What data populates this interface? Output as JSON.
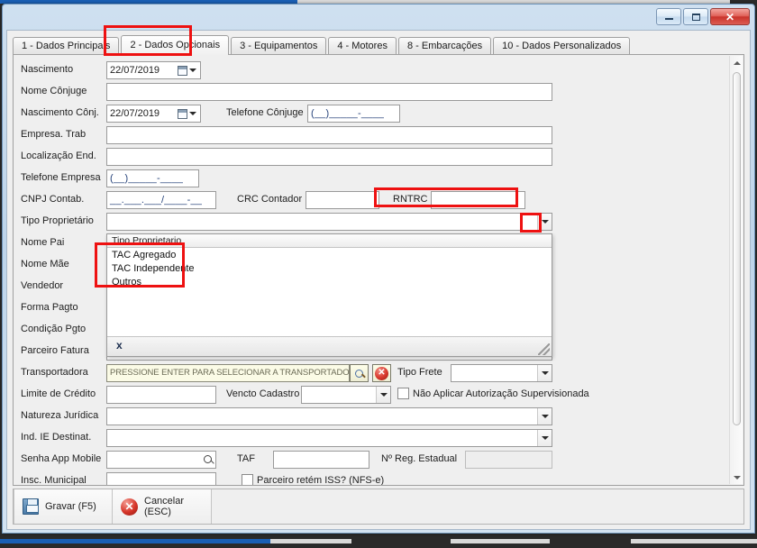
{
  "window": {
    "title": "",
    "buttons": {
      "minimize": "Minimizar",
      "maximize": "Maximizar",
      "close": "Fechar"
    }
  },
  "tabs": [
    {
      "key": "1",
      "label": "1 - Dados Principais",
      "active": false
    },
    {
      "key": "2",
      "label": "2 - Dados Opcionais",
      "active": true
    },
    {
      "key": "3",
      "label": "3 - Equipamentos",
      "active": false
    },
    {
      "key": "4",
      "label": "4 - Motores",
      "active": false
    },
    {
      "key": "8",
      "label": "8 - Embarcações",
      "active": false
    },
    {
      "key": "10",
      "label": "10 - Dados Personalizados",
      "active": false
    }
  ],
  "form": {
    "nascimento": {
      "label": "Nascimento",
      "value": "22/07/2019"
    },
    "nome_conjuge": {
      "label": "Nome Cônjuge",
      "value": ""
    },
    "nascimento_conj": {
      "label": "Nascimento Cônj.",
      "value": "22/07/2019"
    },
    "telefone_conjuge": {
      "label": "Telefone Cônjuge",
      "value": "(__)_____-____"
    },
    "empresa_trab": {
      "label": "Empresa. Trab",
      "value": ""
    },
    "localizacao_end": {
      "label": "Localização End.",
      "value": ""
    },
    "telefone_empresa": {
      "label": "Telefone Empresa",
      "value": "(__)_____-____"
    },
    "cnpj_contab": {
      "label": "CNPJ Contab.",
      "value": "__.___.___/____-__"
    },
    "crc_contador": {
      "label": "CRC Contador",
      "value": ""
    },
    "rntrc": {
      "label": "RNTRC",
      "value": ""
    },
    "tipo_proprietario": {
      "label": "Tipo Proprietário",
      "value": ""
    },
    "nome_pai": {
      "label": "Nome Pai",
      "value": ""
    },
    "nome_mae": {
      "label": "Nome Mãe",
      "value": ""
    },
    "vendedor": {
      "label": "Vendedor",
      "value": ""
    },
    "forma_pagto": {
      "label": "Forma Pagto",
      "value": ""
    },
    "condicao_pgto": {
      "label": "Condição Pgto",
      "value": ""
    },
    "parceiro_fatura": {
      "label": "Parceiro Fatura",
      "value": ""
    },
    "transportadora": {
      "label": "Transportadora",
      "value": "PRESSIONE ENTER PARA SELECIONAR A TRANSPORTADORA"
    },
    "tipo_frete": {
      "label": "Tipo Frete",
      "value": ""
    },
    "limite_credito": {
      "label": "Limite de Crédito",
      "value": ""
    },
    "vencto_cadastro": {
      "label": "Vencto Cadastro",
      "value": ""
    },
    "nao_aplicar_autorizacao": {
      "label": "Não Aplicar Autorização Supervisionada",
      "checked": false
    },
    "natureza_juridica": {
      "label": "Natureza Jurídica",
      "value": ""
    },
    "ind_ie_destinat": {
      "label": "Ind. IE Destinat.",
      "value": ""
    },
    "senha_app_mobile": {
      "label": "Senha App Mobile",
      "value": ""
    },
    "taf": {
      "label": "TAF",
      "value": ""
    },
    "n_reg_estadual": {
      "label": "Nº Reg. Estadual",
      "value": ""
    },
    "insc_municipal": {
      "label": "Insc. Municipal",
      "value": ""
    },
    "parceiro_retem_iss": {
      "label": "Parceiro retém ISS? (NFS-e)",
      "checked": false
    }
  },
  "dropdown": {
    "header": "Tipo Proprietario",
    "options": [
      "TAC Agregado",
      "TAC Independente",
      "Outros"
    ],
    "close_glyph": "x"
  },
  "actions": {
    "save": "Gravar (F5)",
    "cancel": "Cancelar (ESC)"
  },
  "icons": {
    "search": "search-icon",
    "clear": "x",
    "close": "x"
  },
  "colors": {
    "annotation": "#ee1111",
    "titlebar": "#bdd4ea",
    "panel": "#efefef",
    "hint_bg": "#fbfbe6"
  }
}
